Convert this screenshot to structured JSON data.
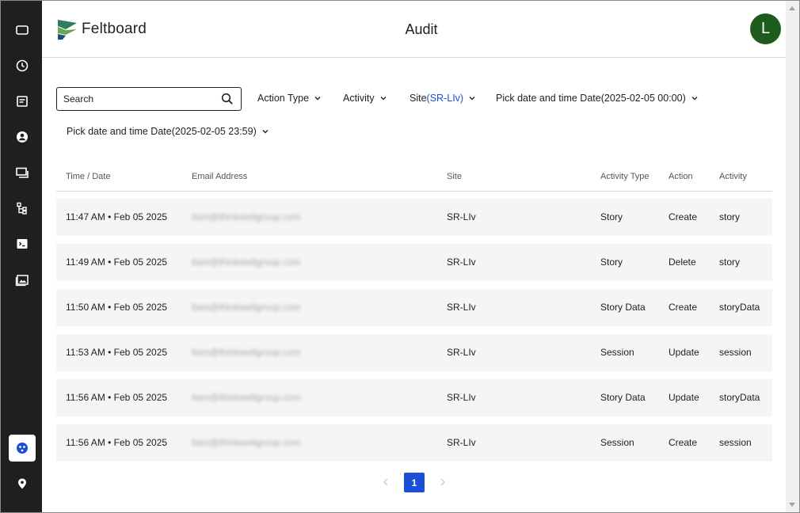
{
  "app": {
    "brand": "Feltboard",
    "page_title": "Audit",
    "user_initial": "L"
  },
  "colors": {
    "accent": "#1a4fd6",
    "sidebar_bg": "#1f1f1f",
    "avatar_bg": "#1e5c1e",
    "row_bg": "#f5f5f5"
  },
  "sidebar": {
    "items": [
      {
        "icon": "screen-icon"
      },
      {
        "icon": "clock-icon"
      },
      {
        "icon": "document-icon"
      },
      {
        "icon": "user-icon"
      },
      {
        "icon": "devices-icon"
      },
      {
        "icon": "hierarchy-icon"
      },
      {
        "icon": "terminal-icon"
      },
      {
        "icon": "image-icon"
      }
    ],
    "bottom": [
      {
        "icon": "audit-icon",
        "active": true
      },
      {
        "icon": "location-icon"
      }
    ]
  },
  "filters": {
    "search_placeholder": "Search",
    "action_type": "Action Type",
    "activity": "Activity",
    "site_label": "Site",
    "site_value": "(SR-LIv)",
    "date_start_label": "Pick date and time Date",
    "date_start_value": "(2025-02-05 00:00)",
    "date_end_label": "Pick date and time Date",
    "date_end_value": "(2025-02-05 23:59)"
  },
  "table": {
    "headers": [
      "Time / Date",
      "Email Address",
      "Site",
      "Activity Type",
      "Action",
      "Activity"
    ],
    "rows": [
      {
        "time": "11:47 AM • Feb 05 2025",
        "email": "ltam@thinkwellgroup.com",
        "site": "SR-LIv",
        "type": "Story",
        "action": "Create",
        "activity": "story"
      },
      {
        "time": "11:49 AM • Feb 05 2025",
        "email": "ltam@thinkwellgroup.com",
        "site": "SR-LIv",
        "type": "Story",
        "action": "Delete",
        "activity": "story"
      },
      {
        "time": "11:50 AM • Feb 05 2025",
        "email": "ltam@thinkwellgroup.com",
        "site": "SR-LIv",
        "type": "Story Data",
        "action": "Create",
        "activity": "storyData"
      },
      {
        "time": "11:53 AM • Feb 05 2025",
        "email": "ltam@thinkwellgroup.com",
        "site": "SR-LIv",
        "type": "Session",
        "action": "Update",
        "activity": "session"
      },
      {
        "time": "11:56 AM • Feb 05 2025",
        "email": "ltam@thinkwellgroup.com",
        "site": "SR-LIv",
        "type": "Story Data",
        "action": "Update",
        "activity": "storyData"
      },
      {
        "time": "11:56 AM • Feb 05 2025",
        "email": "ltam@thinkwellgroup.com",
        "site": "SR-LIv",
        "type": "Session",
        "action": "Create",
        "activity": "session"
      }
    ]
  },
  "pagination": {
    "current": "1"
  }
}
